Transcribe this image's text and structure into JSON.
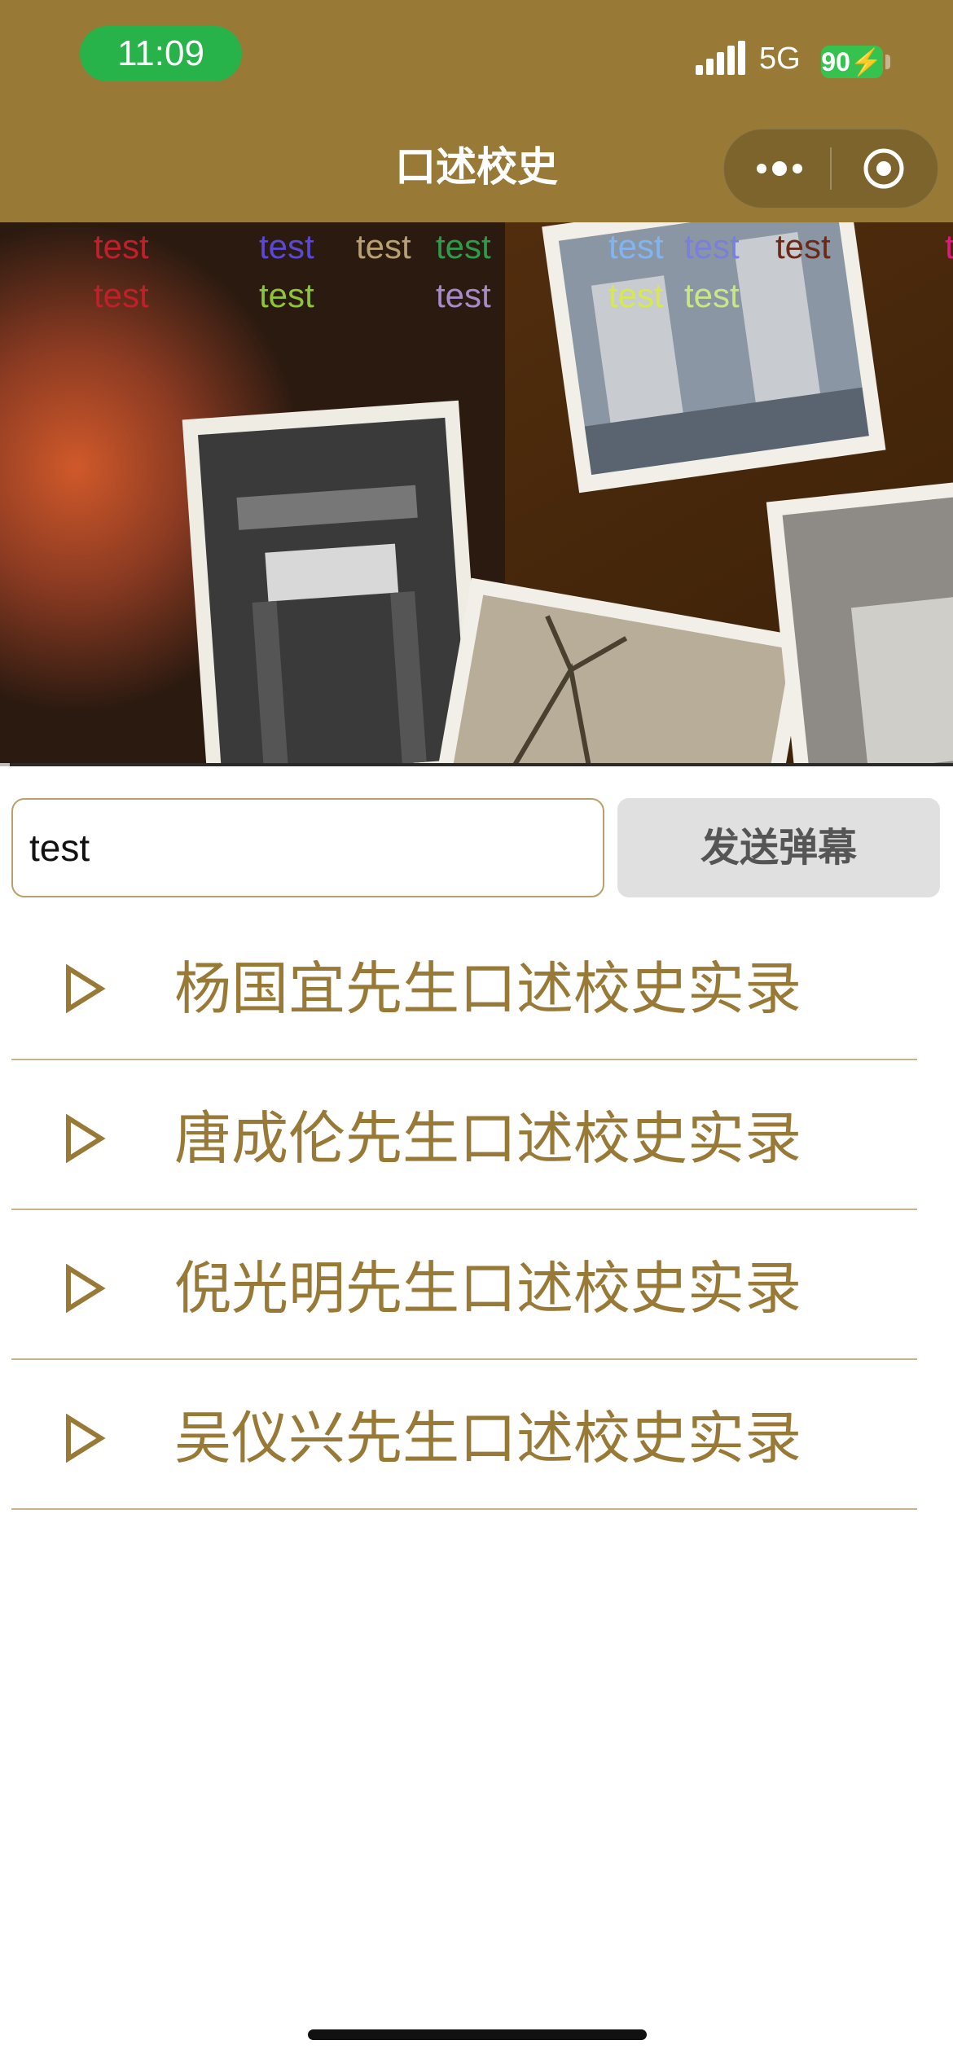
{
  "status_bar": {
    "time": "11:09",
    "network": "5G",
    "battery": "90"
  },
  "nav": {
    "title": "口述校史",
    "more_icon": "more-dots-icon",
    "close_icon": "target-icon"
  },
  "video": {
    "progress_fraction": 0.01,
    "danmaku": [
      {
        "text": "test",
        "color": "#c0202a"
      },
      {
        "text": "test",
        "color": "#5a49d6"
      },
      {
        "text": "test",
        "color": "#b8a070"
      },
      {
        "text": "test",
        "color": "#2e9a4a"
      },
      {
        "text": "test",
        "color": "#82b4f0"
      },
      {
        "text": "test",
        "color": "#7a80d8"
      },
      {
        "text": "test",
        "color": "#6a2a18"
      },
      {
        "text": "t",
        "color": "#e01880"
      },
      {
        "text": "test",
        "color": "#c0202a"
      },
      {
        "text": "test",
        "color": "#8dc43a"
      },
      {
        "text": "test",
        "color": "#a88ac8"
      },
      {
        "text": "test",
        "color": "#d8e850"
      },
      {
        "text": "test",
        "color": "#c8e888"
      }
    ]
  },
  "input": {
    "value": "test",
    "placeholder": ""
  },
  "send_button": {
    "label": "发送弹幕"
  },
  "list": [
    {
      "label": "杨国宜先生口述校史实录",
      "icon": "play-icon"
    },
    {
      "label": "唐成伦先生口述校史实录",
      "icon": "play-icon"
    },
    {
      "label": "倪光明先生口述校史实录",
      "icon": "play-icon"
    },
    {
      "label": "吴仪兴先生口述校史实录",
      "icon": "play-icon"
    }
  ],
  "colors": {
    "brand": "#987a36",
    "status_green": "#27b24a"
  }
}
